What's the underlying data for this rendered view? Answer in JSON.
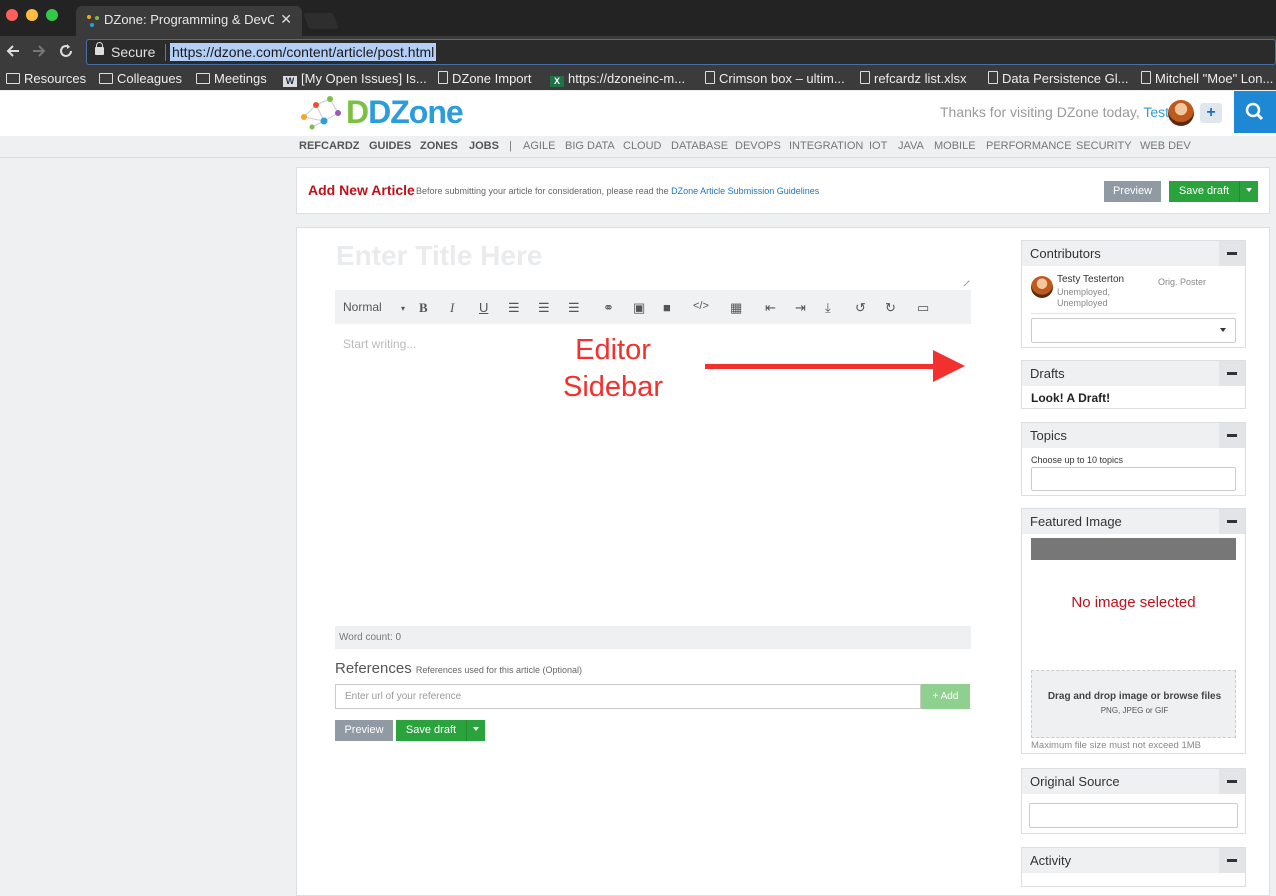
{
  "browser": {
    "tab_title": "DZone: Programming & DevOps",
    "close_glyph": "✕",
    "secure_label": "Secure",
    "url": "https://dzone.com/content/article/post.html",
    "bookmarks": [
      {
        "label": "Resources",
        "icon": "folder-icon"
      },
      {
        "label": "Colleagues",
        "icon": "folder-icon"
      },
      {
        "label": "Meetings",
        "icon": "folder-icon"
      },
      {
        "label": "[My Open Issues] Is...",
        "icon": "w-icon"
      },
      {
        "label": "DZone Import",
        "icon": "file-icon"
      },
      {
        "label": "https://dzoneinc-m...",
        "icon": "excel-icon"
      },
      {
        "label": "Crimson box – ultim...",
        "icon": "file-icon"
      },
      {
        "label": "refcardz list.xlsx",
        "icon": "file-icon"
      },
      {
        "label": "Data Persistence Gl...",
        "icon": "file-icon"
      },
      {
        "label": "Mitchell \"Moe\" Lon...",
        "icon": "file-icon"
      }
    ]
  },
  "header": {
    "logo_text": "DZone",
    "thanks_text": "Thanks for visiting DZone today,",
    "username": "Testy",
    "plus_label": "+"
  },
  "nav": {
    "items": [
      "REFCARDZ",
      "GUIDES",
      "ZONES",
      "JOBS",
      "|",
      "AGILE",
      "BIG DATA",
      "CLOUD",
      "DATABASE",
      "DEVOPS",
      "INTEGRATION",
      "IOT",
      "JAVA",
      "MOBILE",
      "PERFORMANCE",
      "SECURITY",
      "WEB DEV"
    ]
  },
  "addbar": {
    "heading": "Add New Article",
    "subtext": "Before submitting your article for consideration, please read the",
    "guidelines_link": "DZone Article Submission Guidelines",
    "preview_label": "Preview",
    "save_label": "Save draft"
  },
  "editor": {
    "title_placeholder": "Enter Title Here",
    "format_label": "Normal",
    "body_placeholder": "Start writing...",
    "word_count": "Word count: 0",
    "annotation_line1": "Editor",
    "annotation_line2": "Sidebar",
    "toolbar_glyphs": {
      "bold": "B",
      "italic": "I",
      "underline": "U",
      "ordered_list": "☰",
      "bullet_list": "☰",
      "align": "☰",
      "link": "⚭",
      "image": "▣",
      "video": "■",
      "code": "</>",
      "table": "▦",
      "outdent": "⇤",
      "indent": "⇥",
      "download": "⤓",
      "undo": "↺",
      "redo": "↻",
      "fullscreen": "▭"
    }
  },
  "references": {
    "heading": "References",
    "subheading": "References used for this article (Optional)",
    "input_placeholder": "Enter url of your reference",
    "add_label": "+ Add",
    "preview_label": "Preview",
    "save_label": "Save draft"
  },
  "sidebar": {
    "contributors": {
      "title": "Contributors",
      "name": "Testy Testerton",
      "role": "Orig. Poster",
      "line1": "Unemployed,",
      "line2": "Unemployed"
    },
    "drafts": {
      "title": "Drafts",
      "item": "Look! A Draft!"
    },
    "topics": {
      "title": "Topics",
      "hint": "Choose up to 10 topics"
    },
    "featured_image": {
      "title": "Featured Image",
      "status": "No image selected",
      "drop_text": "Drag and drop image or browse files",
      "formats": "PNG, JPEG or GIF",
      "max_size": "Maximum file size must not exceed 1MB"
    },
    "original_source": {
      "title": "Original Source"
    },
    "activity": {
      "title": "Activity"
    }
  },
  "colors": {
    "accent_blue": "#1e88d5",
    "save_green": "#2aa33c",
    "heading_red": "#c0101a",
    "annotation_red": "#f2312f"
  }
}
